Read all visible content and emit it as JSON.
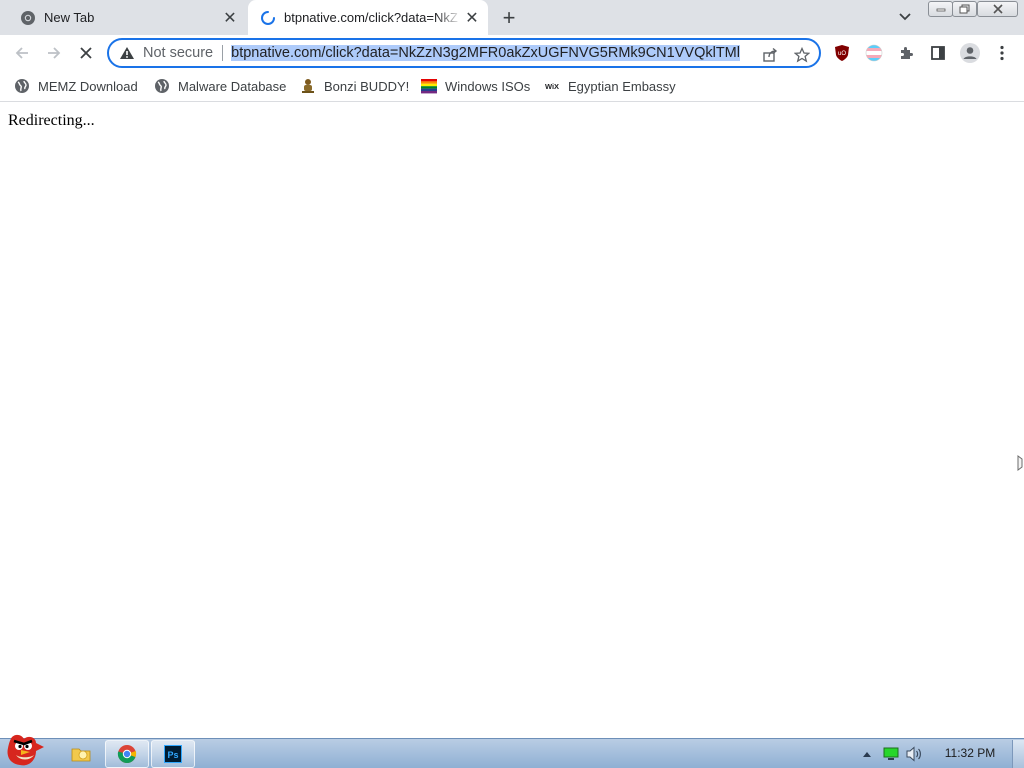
{
  "window": {
    "tabs": [
      {
        "title": "New Tab",
        "icon": "chrome-icon",
        "active": false
      },
      {
        "title": "btpnative.com/click?data=NkZ",
        "icon": "loading-spinner-icon",
        "active": true
      }
    ],
    "new_tab_symbol": "+",
    "close_symbol": "✕"
  },
  "toolbar": {
    "security_label": "Not secure",
    "url": "btpnative.com/click?data=NkZzN3g2MFR0akZxUGFNVG5RMk9CN1VVQklTMl",
    "url_selected": true
  },
  "bookmarks": [
    {
      "label": "MEMZ Download",
      "icon": "globe-icon"
    },
    {
      "label": "Malware Database",
      "icon": "globe-icon"
    },
    {
      "label": "Bonzi BUDDY!",
      "icon": "bonzi-icon"
    },
    {
      "label": "Windows ISOs",
      "icon": "rainbow-flag-icon"
    },
    {
      "label": "Egyptian Embassy",
      "icon": "wix-icon"
    }
  ],
  "page": {
    "message": "Redirecting..."
  },
  "taskbar": {
    "clock": "11:32 PM",
    "apps": [
      "angry-bird-start-icon",
      "explorer-icon",
      "chrome-icon",
      "photoshop-icon"
    ]
  },
  "colors": {
    "tabstrip": "#dee1e6",
    "accent": "#1a73e8",
    "selection": "#aecbfa",
    "taskbar": "#a9c2df"
  }
}
